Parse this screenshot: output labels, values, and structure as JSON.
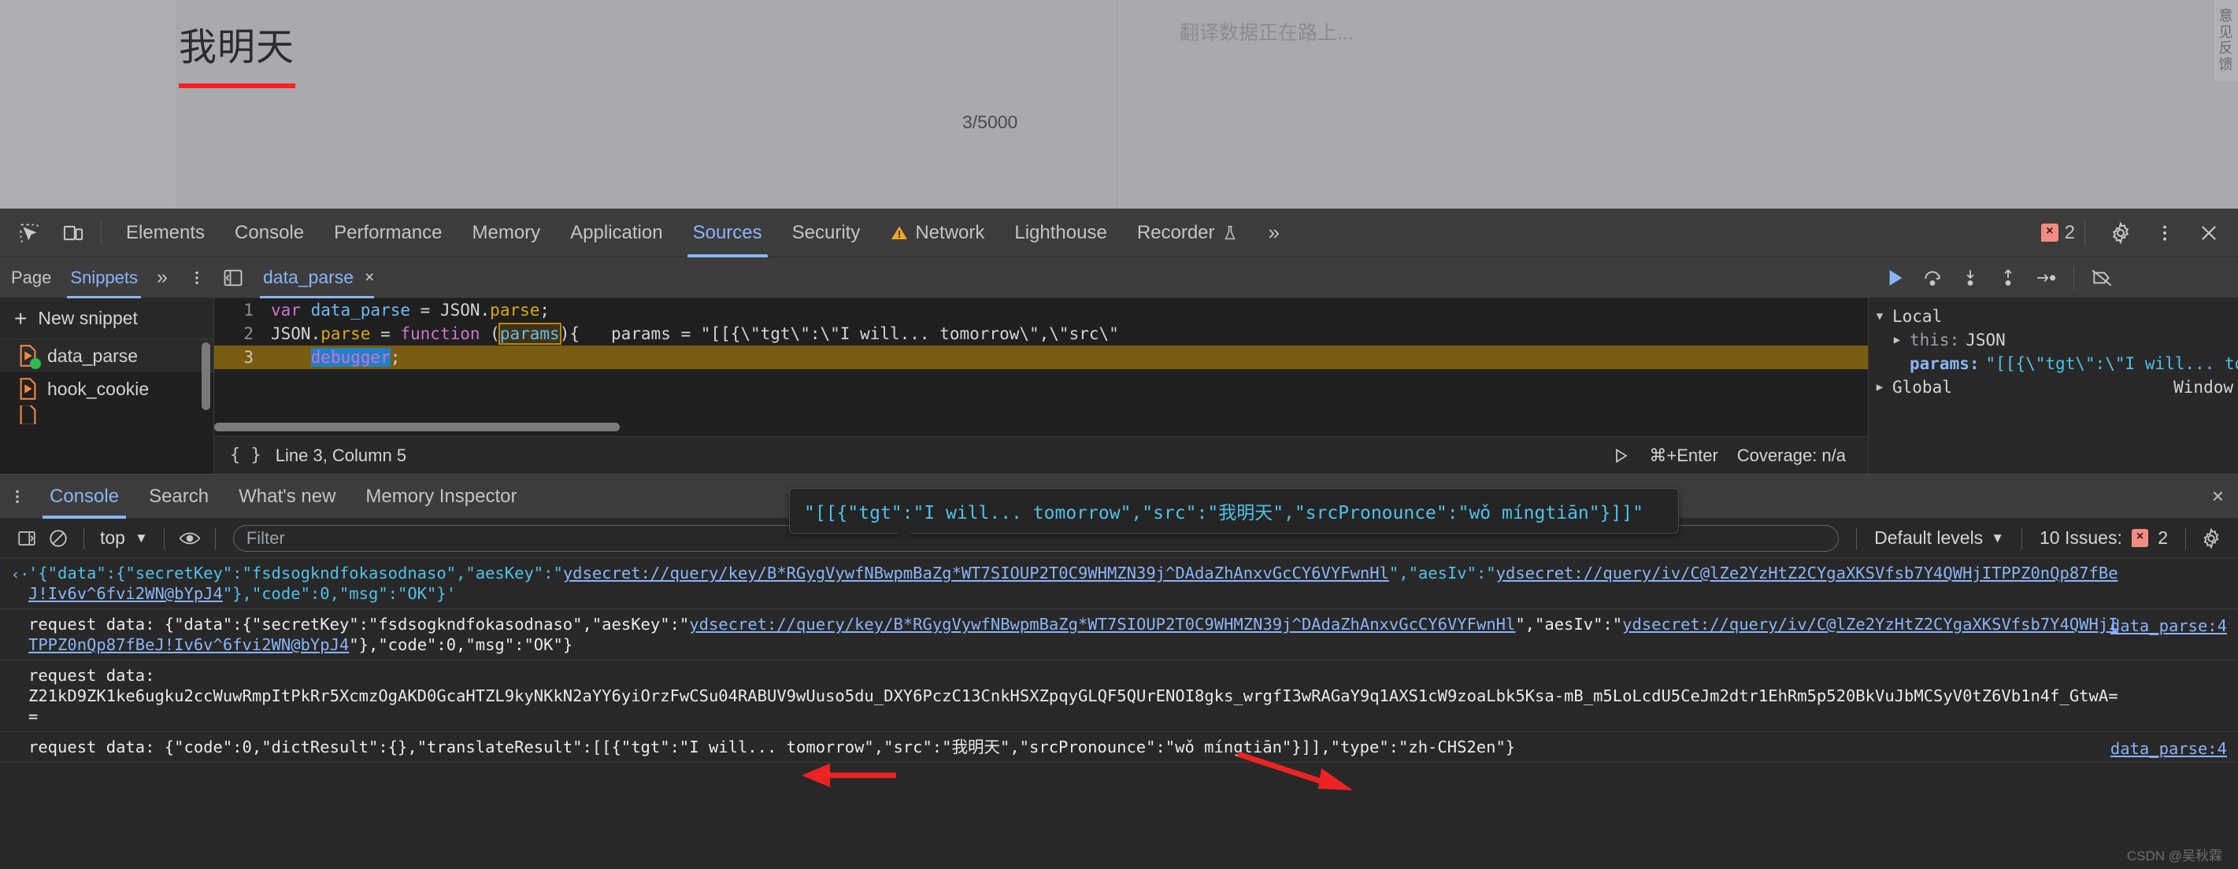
{
  "page": {
    "source_text": "我明天",
    "char_count": "3/5000",
    "target_placeholder": "翻译数据正在路上...",
    "feedback_tab": "意见反馈"
  },
  "devtools": {
    "toolbar": {
      "icons": [
        "inspect-element-icon",
        "device-toolbar-icon"
      ],
      "tabs": [
        {
          "label": "Elements",
          "active": false
        },
        {
          "label": "Console",
          "active": false
        },
        {
          "label": "Performance",
          "active": false
        },
        {
          "label": "Memory",
          "active": false
        },
        {
          "label": "Application",
          "active": false
        },
        {
          "label": "Sources",
          "active": true
        },
        {
          "label": "Security",
          "active": false
        },
        {
          "label": "Network",
          "active": false,
          "warning": true
        },
        {
          "label": "Lighthouse",
          "active": false
        },
        {
          "label": "Recorder",
          "active": false,
          "experiment": true
        }
      ],
      "overflow_label": "»",
      "error_count": "2",
      "error_chip": "×",
      "settings_icon": "gear-icon",
      "more_icon": "kebab-menu-icon",
      "close_icon": "close-icon"
    },
    "snippets": {
      "tabs": [
        {
          "label": "Page",
          "active": false
        },
        {
          "label": "Snippets",
          "active": true
        }
      ],
      "more_label": "»",
      "menu_icon": "kebab-menu-icon",
      "new_snippet_label": "New snippet",
      "new_snippet_plus": "+",
      "items": [
        {
          "name": "data_parse",
          "selected": true,
          "running": true
        },
        {
          "name": "hook_cookie",
          "selected": false,
          "running": false
        }
      ]
    },
    "editor": {
      "tab_label": "data_parse",
      "close_icon": "×",
      "panel_toggle_icon": "show-navigator-icon",
      "lines": [
        {
          "num": "1",
          "parts": [
            {
              "t": "var ",
              "c": "kw"
            },
            {
              "t": "data_parse",
              "c": "var"
            },
            {
              "t": " = ",
              "c": "plain"
            },
            {
              "t": "JSON.",
              "c": "plain"
            },
            {
              "t": "parse",
              "c": "fn"
            },
            {
              "t": ";",
              "c": "plain"
            }
          ]
        },
        {
          "num": "2",
          "parts": [
            {
              "t": "JSON.",
              "c": "plain"
            },
            {
              "t": "parse",
              "c": "fn"
            },
            {
              "t": " = ",
              "c": "plain"
            },
            {
              "t": "function ",
              "c": "kw"
            },
            {
              "t": "(",
              "c": "plain"
            },
            {
              "t": "params",
              "c": "box"
            },
            {
              "t": "){",
              "c": "plain"
            }
          ]
        },
        {
          "num": "3",
          "parts": [
            {
              "t": "    ",
              "c": "plain"
            },
            {
              "t": "debugger",
              "c": "sel"
            },
            {
              "t": ";",
              "c": "plain"
            }
          ]
        }
      ],
      "inline_hint": "params = \"[[{\\\"tgt\\\":\\\"I will... tomorrow\\\",\\\"src\\\"",
      "status_brace": "{ }",
      "status_position": "Line 3, Column 5",
      "run_shortcut": "⌘+Enter",
      "coverage": "Coverage: n/a",
      "run_icon": "run-snippet-icon"
    },
    "tooltip": "\"[[{\"tgt\":\"I will... tomorrow\",\"src\":\"我明天\",\"srcPronounce\":\"wǒ míngtiān\"}]]\"",
    "debugger": {
      "buttons": [
        "resume-icon",
        "step-over-icon",
        "step-into-icon",
        "step-out-icon",
        "step-icon",
        "deactivate-breakpoints-icon"
      ],
      "scopes": [
        {
          "tri": "▼",
          "name": "Local",
          "right": ""
        },
        {
          "tri": "▶",
          "prop": "this:",
          "value": "JSON",
          "indent": 1
        },
        {
          "tri": "",
          "key": "params:",
          "value": "\"[[{\\\"tgt\\\":\\\"I will... tomorrow\\\"",
          "indent": 1
        },
        {
          "tri": "▶",
          "name": "Global",
          "right": "Window"
        }
      ]
    },
    "drawer": {
      "menu_icon": "kebab-menu-icon",
      "tabs": [
        {
          "label": "Console",
          "active": true
        },
        {
          "label": "Search",
          "active": false
        },
        {
          "label": "What's new",
          "active": false
        },
        {
          "label": "Memory Inspector",
          "active": false
        }
      ],
      "close_icon": "×"
    },
    "console_toolbar": {
      "sidebar_icon": "console-sidebar-icon",
      "clear_icon": "clear-console-icon",
      "context": "top",
      "context_caret": "▼",
      "eye_icon": "live-expression-icon",
      "filter_placeholder": "Filter",
      "filter_value": "",
      "levels": "Default levels",
      "levels_caret": "▼",
      "issues_label": "10 Issues:",
      "issues_chip": "×",
      "issues_count": "2",
      "settings_icon": "gear-icon"
    },
    "console_entries": [
      {
        "type": "evaluated",
        "arrow": "‹·",
        "source": "",
        "segments": [
          {
            "t": "'{\"data\":{\"secretKey\":\"fsdsogkndfokasodnaso\",\"aesKey\":\"",
            "c": "eval"
          },
          {
            "t": "ydsecret://query/key/B*RGygVywfNBwpmBaZg*WT7SIOUP2T0C9WHMZN39j^DAdaZhAnxvGcCY6VYFwnHl",
            "c": "link"
          },
          {
            "t": "\",\"aesIv\":\"",
            "c": "eval"
          },
          {
            "t": "ydsecret://query/iv/C@lZe2YzHtZ2CYgaXKSVfsb7Y4QWHjITPPZ0nQp87fBeJ!Iv6v^6fvi2WN@bYpJ4",
            "c": "link"
          },
          {
            "t": "\"},\"code\":0,\"msg\":\"OK\"}'",
            "c": "eval"
          }
        ]
      },
      {
        "type": "log",
        "arrow": "",
        "source": "data_parse:4",
        "segments": [
          {
            "t": "request data: {\"data\":{\"secretKey\":\"fsdsogkndfokasodnaso\",\"aesKey\":\"",
            "c": "white"
          },
          {
            "t": "ydsecret://query/key/B*RGygVywfNBwpmBaZg*WT7SIOUP2T0C9WHMZN39j^DAdaZhAnxvGcCY6VYFwnHl",
            "c": "link"
          },
          {
            "t": "\",\"aesIv\":\"",
            "c": "white"
          },
          {
            "t": "ydsecret://query/iv/C@lZe2YzHtZ2CYgaXKSVfsb7Y4QWHjITPPZ0nQp87fBeJ!Iv6v^6fvi2WN@bYpJ4",
            "c": "link"
          },
          {
            "t": "\"},\"code\":0,\"msg\":\"OK\"}",
            "c": "white"
          }
        ]
      },
      {
        "type": "log",
        "arrow": "",
        "source": "",
        "segments": [
          {
            "t": "request data:\nZ21kD9ZK1ke6ugku2ccWuwRmpItPkRr5XcmzOgAKD0GcaHTZL9kyNKkN2aYY6yiOrzFwCSu04RABUV9wUuso5du_DXY6PczC13CnkHSXZpqyGLQF5QUrENOI8gks_wrgfI3wRAGaY9q1AXS1cW9zoaLbk5Ksa-mB_m5LoLcdU5CeJm2dtr1EhRm5p520BkVuJbMCSyV0tZ6Vb1n4f_GtwA==",
            "c": "white"
          }
        ]
      },
      {
        "type": "log",
        "arrow": "",
        "source": "data_parse:4",
        "segments": [
          {
            "t": "request data: {\"code\":0,\"dictResult\":{},\"translateResult\":[[{\"tgt\":\"I will... tomorrow\",\"src\":\"我明天\",\"srcPronounce\":\"wǒ míngtiān\"}]],\"type\":\"zh-CHS2en\"}",
            "c": "white"
          }
        ]
      }
    ],
    "watermark": "CSDN @吴秋霖"
  },
  "colors": {
    "accent": "#8ab4f8",
    "error": "#f28b82",
    "string": "#4fc1e9",
    "keyword": "#d072d0",
    "function": "#d9a814",
    "annotation_arrow": "#ee2222"
  }
}
